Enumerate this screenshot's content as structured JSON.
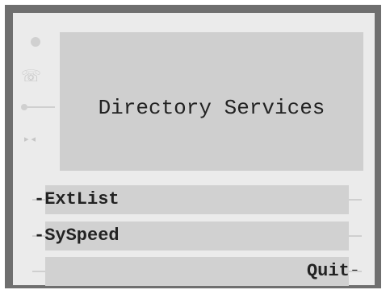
{
  "screen": {
    "title": "Directory Services"
  },
  "status_icons": [
    "status-dot-icon",
    "phone-icon",
    "line-icon",
    "arrows-icon"
  ],
  "softkeys": [
    {
      "label": "-ExtList",
      "side": "left"
    },
    {
      "label": "-SySpeed",
      "side": "left"
    },
    {
      "label": "Quit-",
      "side": "right"
    }
  ],
  "colors": {
    "bezel": "#6f6f6f",
    "screen": "#ebebeb",
    "panel": "#cfcfcf",
    "softkey": "#d1d1d1",
    "text": "#222222"
  }
}
